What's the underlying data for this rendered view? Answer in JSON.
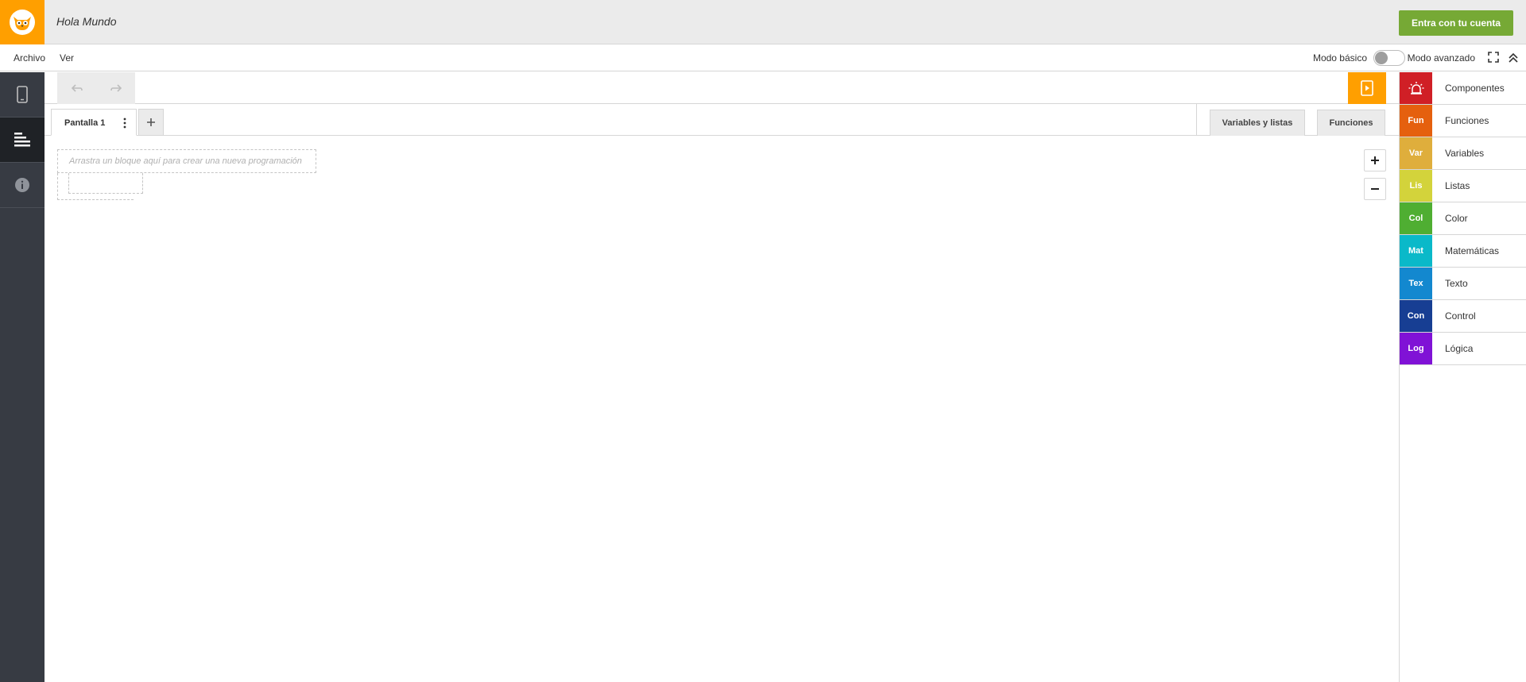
{
  "header": {
    "project_title": "Hola Mundo",
    "login_label": "Entra con tu cuenta",
    "logo_icon": "owl-logo-icon",
    "accent_color": "#ff9f00",
    "login_color": "#76a935"
  },
  "menubar": {
    "file_label": "Archivo",
    "view_label": "Ver",
    "mode_basic_label": "Modo básico",
    "mode_advanced_label": "Modo avanzado",
    "advanced_mode_enabled": false
  },
  "sidebar": {
    "items": [
      {
        "icon": "phone-icon",
        "active": false
      },
      {
        "icon": "blocks-icon",
        "active": true
      },
      {
        "icon": "info-icon",
        "active": false
      }
    ]
  },
  "toolbar": {
    "undo_icon": "undo-icon",
    "redo_icon": "redo-icon",
    "run_icon": "run-app-icon"
  },
  "tabs": {
    "screen_tab_label": "Pantalla 1",
    "add_screen_symbol": "+",
    "variables_tab_label": "Variables y listas",
    "functions_tab_label": "Funciones"
  },
  "workspace": {
    "drop_hint": "Arrastra un bloque aquí para crear una nueva programación",
    "zoom_in_symbol": "+",
    "zoom_out_symbol": "−"
  },
  "palette": {
    "categories": [
      {
        "abbr": "",
        "icon": "alarm-icon",
        "label": "Componentes",
        "color": "#d01f26"
      },
      {
        "abbr": "Fun",
        "label": "Funciones",
        "color": "#e5600e"
      },
      {
        "abbr": "Var",
        "label": "Variables",
        "color": "#dfae3c"
      },
      {
        "abbr": "Lis",
        "label": "Listas",
        "color": "#d3d33b"
      },
      {
        "abbr": "Col",
        "label": "Color",
        "color": "#4fae32"
      },
      {
        "abbr": "Mat",
        "label": "Matemáticas",
        "color": "#0ab9c9"
      },
      {
        "abbr": "Tex",
        "label": "Texto",
        "color": "#1388cf"
      },
      {
        "abbr": "Con",
        "label": "Control",
        "color": "#173e93"
      },
      {
        "abbr": "Log",
        "label": "Lógica",
        "color": "#8012d6"
      }
    ]
  }
}
